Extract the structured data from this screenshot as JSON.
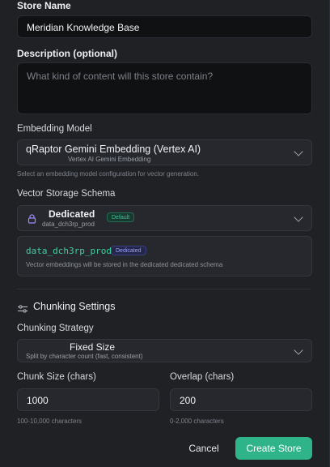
{
  "store_name": {
    "label": "Store Name",
    "value": "Meridian Knowledge Base"
  },
  "description": {
    "label": "Description (optional)",
    "placeholder": "What kind of content will this store contain?"
  },
  "embedding_model": {
    "label": "Embedding Model",
    "selected": "qRaptor Gemini Embedding (Vertex AI)",
    "selected_sub": "Vertex AI Gemini Embedding",
    "help": "Select an embedding model configuration for vector generation."
  },
  "vector_schema": {
    "label": "Vector Storage Schema",
    "selected": "Dedicated",
    "selected_sub": "data_dch3rp_prod",
    "badge": "Default",
    "info_schema": "data_dch3rp_prod",
    "info_badge": "Dedicated",
    "info_text": "Vector embeddings will be stored in the dedicated dedicated schema",
    "lock_icon": "lock-icon"
  },
  "chunking": {
    "section_title": "Chunking Settings",
    "section_icon": "sliders-icon",
    "strategy_label": "Chunking Strategy",
    "strategy_selected": "Fixed Size",
    "strategy_sub": "Split by character count (fast, consistent)",
    "chunk_size_label": "Chunk Size (chars)",
    "chunk_size_value": "1000",
    "chunk_size_help": "100-10,000 characters",
    "overlap_label": "Overlap (chars)",
    "overlap_value": "200",
    "overlap_help": "0-2,000 characters"
  },
  "actions": {
    "cancel": "Cancel",
    "create": "Create Store"
  },
  "colors": {
    "accent": "#2fb388",
    "background": "#1f2125",
    "badge_default": "#39c29a",
    "badge_dedicated": "#8a93ff"
  }
}
